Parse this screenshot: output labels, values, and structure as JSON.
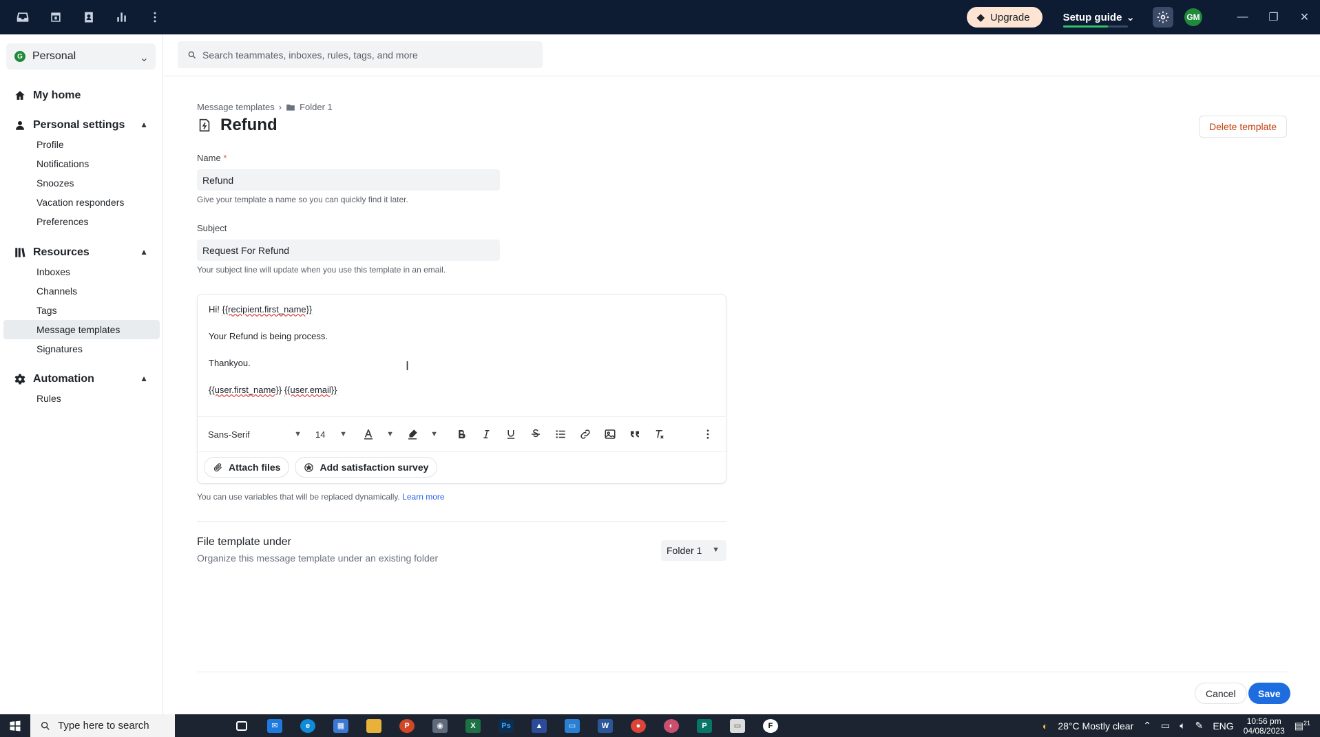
{
  "topbar": {
    "upgrade_label": "Upgrade",
    "setup_label": "Setup guide",
    "setup_progress": 0.7,
    "avatar_initials": "GM"
  },
  "workspace": {
    "initial": "G",
    "name": "Personal"
  },
  "nav": {
    "my_home": "My home",
    "personal_settings": {
      "label": "Personal settings",
      "items": [
        "Profile",
        "Notifications",
        "Snoozes",
        "Vacation responders",
        "Preferences"
      ]
    },
    "resources": {
      "label": "Resources",
      "items": [
        "Inboxes",
        "Channels",
        "Tags",
        "Message templates",
        "Signatures"
      ],
      "active": "Message templates"
    },
    "automation": {
      "label": "Automation",
      "items": [
        "Rules"
      ]
    }
  },
  "search": {
    "placeholder": "Search teammates, inboxes, rules, tags, and more"
  },
  "breadcrumb": {
    "root": "Message templates",
    "folder": "Folder 1"
  },
  "page": {
    "title": "Refund",
    "delete_label": "Delete template"
  },
  "form": {
    "name_label": "Name",
    "name_required": "*",
    "name_value": "Refund",
    "name_hint": "Give your template a name so you can quickly find it later.",
    "subject_label": "Subject",
    "subject_value": "Request For Refund",
    "subject_hint": "Your subject line will update when you use this template in an email."
  },
  "editor": {
    "line1_prefix": "Hi! ",
    "line1_var": "{{recipient.first_name}}",
    "line2": "Your Refund is being process.",
    "line3": "Thankyou.",
    "line4_var1": "{{user.first_name}}",
    "line4_sep": " ",
    "line4_var2": "{{user.email}}",
    "font_family": "Sans-Serif",
    "font_size": "14",
    "attach_label": "Attach files",
    "survey_label": "Add satisfaction survey"
  },
  "variables_hint": {
    "text": "You can use variables that will be replaced dynamically. ",
    "link": "Learn more"
  },
  "file_under": {
    "title": "File template under",
    "subtitle": "Organize this message template under an existing folder",
    "selected": "Folder 1"
  },
  "actions": {
    "cancel": "Cancel",
    "save": "Save"
  },
  "taskbar": {
    "search_text": "Type here to search",
    "weather": "28°C  Mostly clear",
    "lang": "ENG",
    "time": "10:56 pm",
    "date": "04/08/2023",
    "notif_count": "21"
  }
}
